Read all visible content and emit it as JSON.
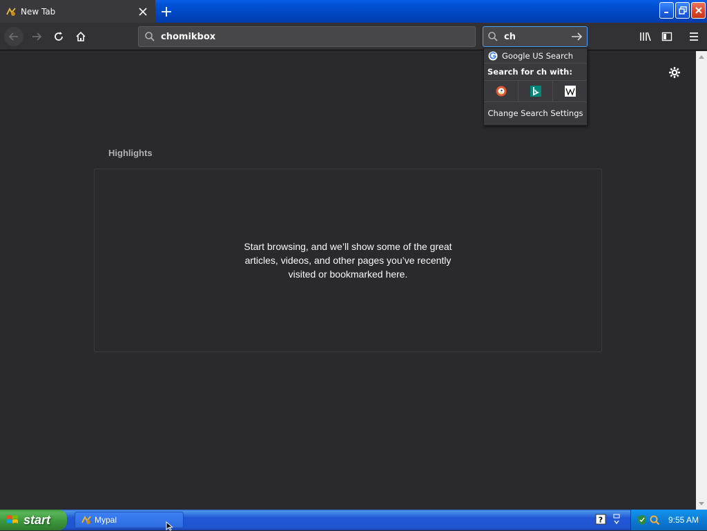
{
  "tab": {
    "title": "New Tab"
  },
  "toolbar": {
    "url_value": "chomikbox",
    "search_value": "ch"
  },
  "search_popup": {
    "default_engine": "Google US Search",
    "search_with_label": "Search for ch with:",
    "alt_engines": [
      "duckduckgo-icon",
      "bing-icon",
      "wikipedia-icon"
    ],
    "settings_label": "Change Search Settings"
  },
  "content": {
    "highlights_title": "Highlights",
    "empty_message": "Start browsing, and we’ll show some of the great articles, videos, and other pages you’ve recently visited or bookmarked here."
  },
  "taskbar": {
    "start_label": "start",
    "task_label": "Mypal",
    "clock": "9:55 AM"
  },
  "colors": {
    "content_bg": "#2a2a2e",
    "toolbar_bg": "#323234",
    "accent": "#45a1ff",
    "xp_blue": "#2157d7",
    "xp_green": "#3b943b"
  }
}
